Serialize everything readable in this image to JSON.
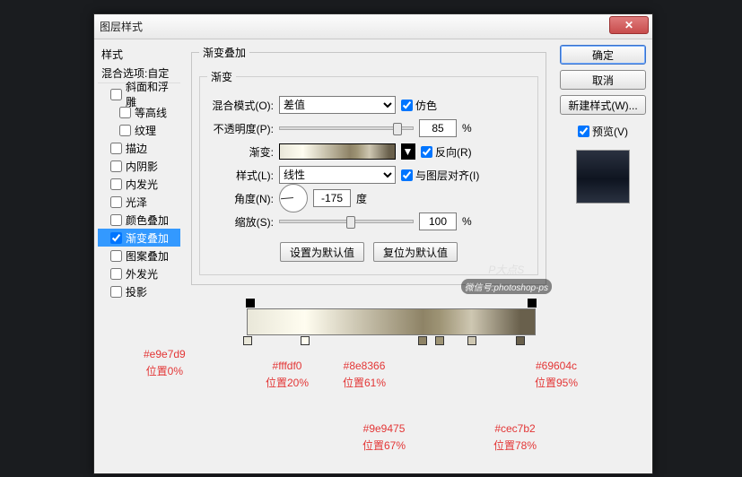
{
  "window": {
    "title": "图层样式"
  },
  "left": {
    "styles_header": "样式",
    "blend_options": "混合选项:自定",
    "items": [
      {
        "label": "斜面和浮雕",
        "checked": false,
        "indent": 1
      },
      {
        "label": "等高线",
        "checked": false,
        "indent": 2
      },
      {
        "label": "纹理",
        "checked": false,
        "indent": 2
      },
      {
        "label": "描边",
        "checked": false,
        "indent": 1
      },
      {
        "label": "内阴影",
        "checked": false,
        "indent": 1
      },
      {
        "label": "内发光",
        "checked": false,
        "indent": 1
      },
      {
        "label": "光泽",
        "checked": false,
        "indent": 1
      },
      {
        "label": "颜色叠加",
        "checked": false,
        "indent": 1
      },
      {
        "label": "渐变叠加",
        "checked": true,
        "indent": 1,
        "active": true
      },
      {
        "label": "图案叠加",
        "checked": false,
        "indent": 1
      },
      {
        "label": "外发光",
        "checked": false,
        "indent": 1
      },
      {
        "label": "投影",
        "checked": false,
        "indent": 1
      }
    ]
  },
  "center": {
    "section_title": "渐变叠加",
    "subsection_title": "渐变",
    "blend_mode_label": "混合模式(O):",
    "blend_mode_value": "差值",
    "dither_label": "仿色",
    "opacity_label": "不透明度(P):",
    "opacity_value": "85",
    "percent": "%",
    "gradient_label": "渐变:",
    "reverse_label": "反向(R)",
    "style_label": "样式(L):",
    "style_value": "线性",
    "align_label": "与图层对齐(I)",
    "angle_label": "角度(N):",
    "angle_value": "-175",
    "degree": "度",
    "scale_label": "缩放(S):",
    "scale_value": "100",
    "set_default": "设置为默认值",
    "reset_default": "复位为默认值"
  },
  "right": {
    "ok": "确定",
    "cancel": "取消",
    "new_style": "新建样式(W)...",
    "preview": "预览(V)"
  },
  "gradient_stops": [
    {
      "color": "#e9e7d9",
      "pos": 0,
      "label_color": "#e9e7d9",
      "label_pos": "位置0%"
    },
    {
      "color": "#fffdf0",
      "pos": 20,
      "label_color": "#fffdf0",
      "label_pos": "位置20%"
    },
    {
      "color": "#8e8366",
      "pos": 61,
      "label_color": "#8e8366",
      "label_pos": "位置61%"
    },
    {
      "color": "#9e9475",
      "pos": 67,
      "label_color": "#9e9475",
      "label_pos": "位置67%"
    },
    {
      "color": "#cec7b2",
      "pos": 78,
      "label_color": "#cec7b2",
      "label_pos": "位置78%"
    },
    {
      "color": "#69604c",
      "pos": 95,
      "label_color": "#69604c",
      "label_pos": "位置95%"
    }
  ],
  "watermark": {
    "brand": "P大点S",
    "sub": "微信号:photoshop-ps"
  }
}
